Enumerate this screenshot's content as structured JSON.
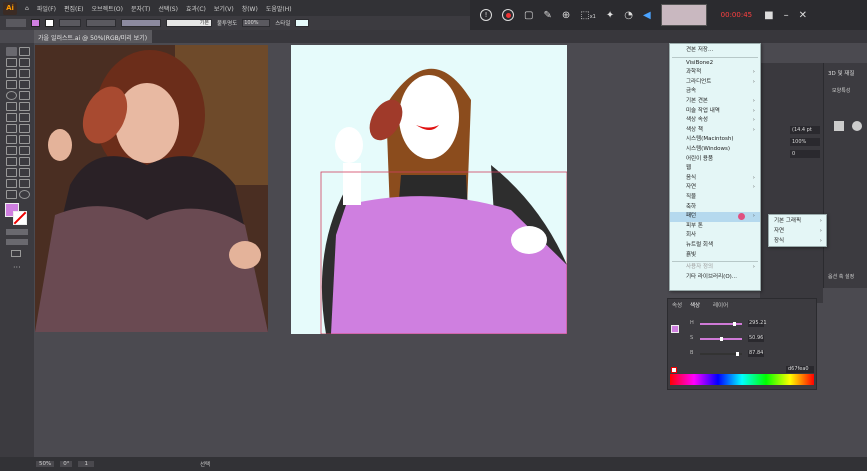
{
  "menubar": {
    "items": [
      "파일(F)",
      "편집(E)",
      "오브젝트(O)",
      "문자(T)",
      "선택(S)",
      "효과(C)",
      "보기(V)",
      "창(W)",
      "도움말(H)"
    ]
  },
  "controlbar": {
    "stroke_label": "기본",
    "opacity_label": "불투명도",
    "opacity_value": "100%",
    "style_label": "스타일"
  },
  "recorder": {
    "timer": "00:00:45",
    "timer_color": "#ff4040",
    "zoom_badge": "x1"
  },
  "document_tab": {
    "label": "가을 일러스트.ai @ 50%(RGB/미리 보기)"
  },
  "context_menu": {
    "items": [
      {
        "label": "견본 저장...",
        "arrow": false,
        "highlight": false,
        "dim": false
      },
      {
        "label": "VisiBone2",
        "arrow": false,
        "highlight": false,
        "dim": false
      },
      {
        "label": "과학적",
        "arrow": true,
        "highlight": false,
        "dim": false
      },
      {
        "label": "그라디언트",
        "arrow": true,
        "highlight": false,
        "dim": false
      },
      {
        "label": "금속",
        "arrow": false,
        "highlight": false,
        "dim": false
      },
      {
        "label": "기본 견본",
        "arrow": true,
        "highlight": false,
        "dim": false
      },
      {
        "label": "미술 작업 내역",
        "arrow": true,
        "highlight": false,
        "dim": false
      },
      {
        "label": "색상 속성",
        "arrow": true,
        "highlight": false,
        "dim": false
      },
      {
        "label": "색상 책",
        "arrow": true,
        "highlight": false,
        "dim": false
      },
      {
        "label": "시스템(Macintosh)",
        "arrow": false,
        "highlight": false,
        "dim": false
      },
      {
        "label": "시스템(Windows)",
        "arrow": false,
        "highlight": false,
        "dim": false
      },
      {
        "label": "어린이 용품",
        "arrow": false,
        "highlight": false,
        "dim": false
      },
      {
        "label": "웹",
        "arrow": false,
        "highlight": false,
        "dim": false
      },
      {
        "label": "음식",
        "arrow": true,
        "highlight": false,
        "dim": false
      },
      {
        "label": "자연",
        "arrow": true,
        "highlight": false,
        "dim": false
      },
      {
        "label": "직물",
        "arrow": false,
        "highlight": false,
        "dim": false
      },
      {
        "label": "축하",
        "arrow": false,
        "highlight": false,
        "dim": false
      },
      {
        "label": "패턴",
        "arrow": true,
        "highlight": true,
        "dim": false
      },
      {
        "label": "피부 톤",
        "arrow": false,
        "highlight": false,
        "dim": false
      },
      {
        "label": "회사",
        "arrow": false,
        "highlight": false,
        "dim": false
      },
      {
        "label": "뉴트럴 회색",
        "arrow": false,
        "highlight": false,
        "dim": false
      },
      {
        "label": "흙빛",
        "arrow": false,
        "highlight": false,
        "dim": false
      },
      {
        "label": "사용자 정의",
        "arrow": true,
        "highlight": false,
        "dim": true
      },
      {
        "label": "기타 라이브러리(O)...",
        "arrow": false,
        "highlight": false,
        "dim": false
      }
    ]
  },
  "submenu": {
    "items": [
      {
        "label": "기본 그래픽",
        "arrow": true
      },
      {
        "label": "자연",
        "arrow": true
      },
      {
        "label": "장식",
        "arrow": true
      }
    ]
  },
  "right_panel": {
    "header": "3D 및 재질",
    "tab": "모양특성",
    "values": [
      "(14.4 pt",
      "100%",
      "0"
    ],
    "bottom": "옵션 축 설정"
  },
  "color_panel": {
    "tabs": [
      "속성",
      "색상",
      "레이어"
    ],
    "h_value": "295.21",
    "s_value": "50.96",
    "b_value": "87.84",
    "hex_value": "d67fea0",
    "fill_color": "#cf7fe0",
    "h_fraction": 0.82,
    "s_fraction": 0.51,
    "b_fraction": 0.88
  },
  "statusbar": {
    "zoom": "50%",
    "rotation": "0°",
    "artboard_num": "1",
    "tool": "선택"
  },
  "colors": {
    "accent_pink": "#cf7fe0",
    "highlight_blue": "#b5d9ee",
    "menu_bg": "#e4f6f6"
  }
}
